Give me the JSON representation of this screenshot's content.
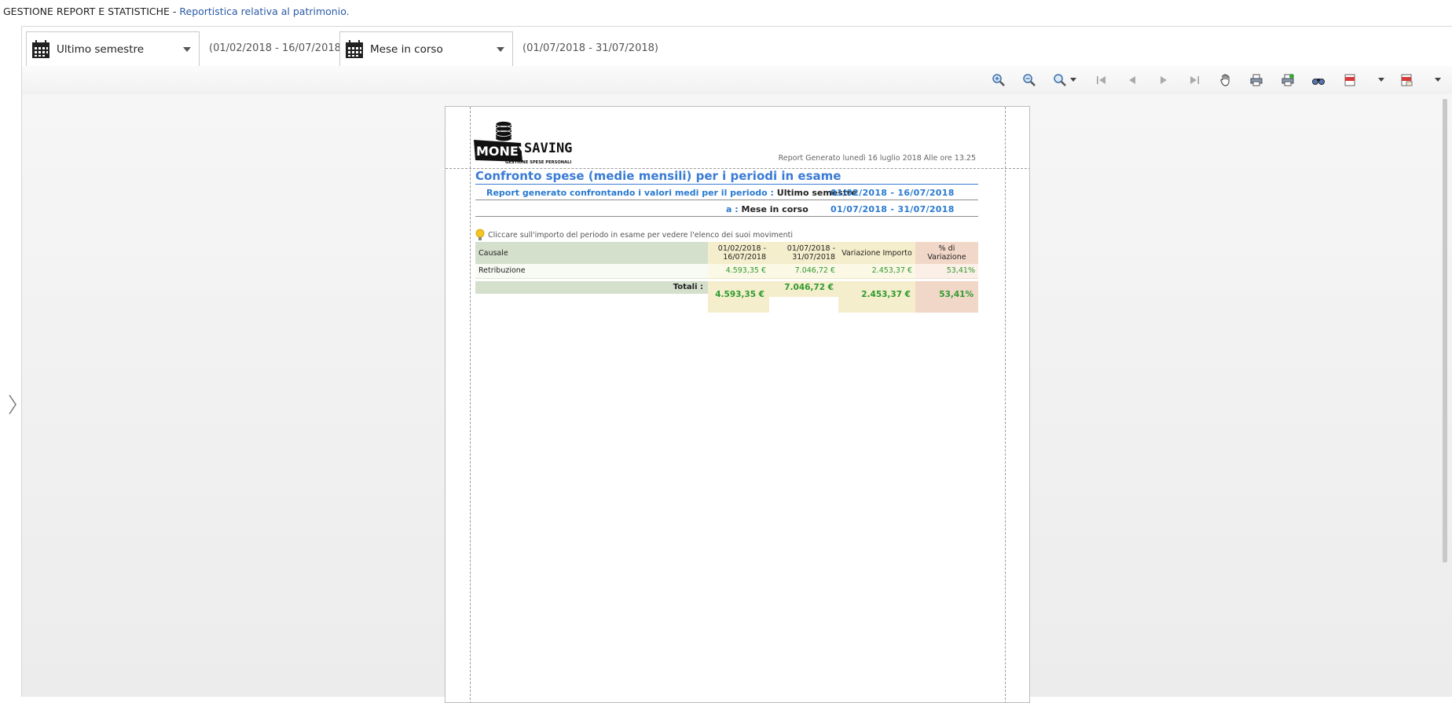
{
  "header": {
    "section": "GESTIONE REPORT E STATISTICHE",
    "separator": " - ",
    "subtitle": "Reportistica relativa al patrimonio."
  },
  "periods": {
    "first": {
      "label": "Ultimo semestre",
      "range": "(01/02/2018 - 16/07/2018)"
    },
    "second": {
      "label": "Mese in corso",
      "range": "(01/07/2018 - 31/07/2018)"
    }
  },
  "toolbar": {
    "icons": [
      "zoom-in-icon",
      "zoom-out-icon",
      "zoom-menu-icon",
      "first-page-icon",
      "previous-page-icon",
      "next-page-icon",
      "last-page-icon",
      "hand-tool-icon",
      "print-icon",
      "quick-print-icon",
      "find-icon",
      "export-pdf-icon",
      "send-pdf-icon"
    ]
  },
  "report": {
    "logo_main_left": "MONEY",
    "logo_main_right": "SAVING",
    "logo_tag": "GESTIONE SPESE PERSONALI",
    "generated": "Report Generato lunedì 16 luglio 2018 Alle ore 13.25",
    "title": "Confronto spese (medie mensili) per i periodi in esame",
    "compare_label": "Report generato confrontando i valori medi per il periodo :",
    "compare_period": "Ultimo semestre",
    "compare_dates": "01/02/2018 - 16/07/2018",
    "to_label": "a :",
    "to_period": "Mese in corso",
    "to_dates": "01/07/2018 - 31/07/2018",
    "hint": "Cliccare sull'importo del periodo in esame per vedere l'elenco dei suoi movimenti",
    "columns": {
      "causale": "Causale",
      "p1_line1": "01/02/2018 -",
      "p1_line2": "16/07/2018",
      "p2_line1": "01/07/2018 -",
      "p2_line2": "31/07/2018",
      "variazione": "Variazione Importo",
      "percentuale": "% di Variazione"
    },
    "rows": [
      {
        "causale": "Retribuzione",
        "p1": "4.593,35 €",
        "p2": "7.046,72 €",
        "variazione": "2.453,37 €",
        "percentuale": "53,41%"
      }
    ],
    "totals": {
      "label": "Totali :",
      "p1": "4.593,35 €",
      "p2": "7.046,72 €",
      "variazione": "2.453,37 €",
      "percentuale": "53,41%"
    }
  },
  "colors": {
    "accent_blue": "#3a7bd5",
    "value_green": "#2f9a2f",
    "header_green": "#d4dfcc",
    "header_yellow": "#f5eecc",
    "header_salmon": "#f1d7c8"
  }
}
